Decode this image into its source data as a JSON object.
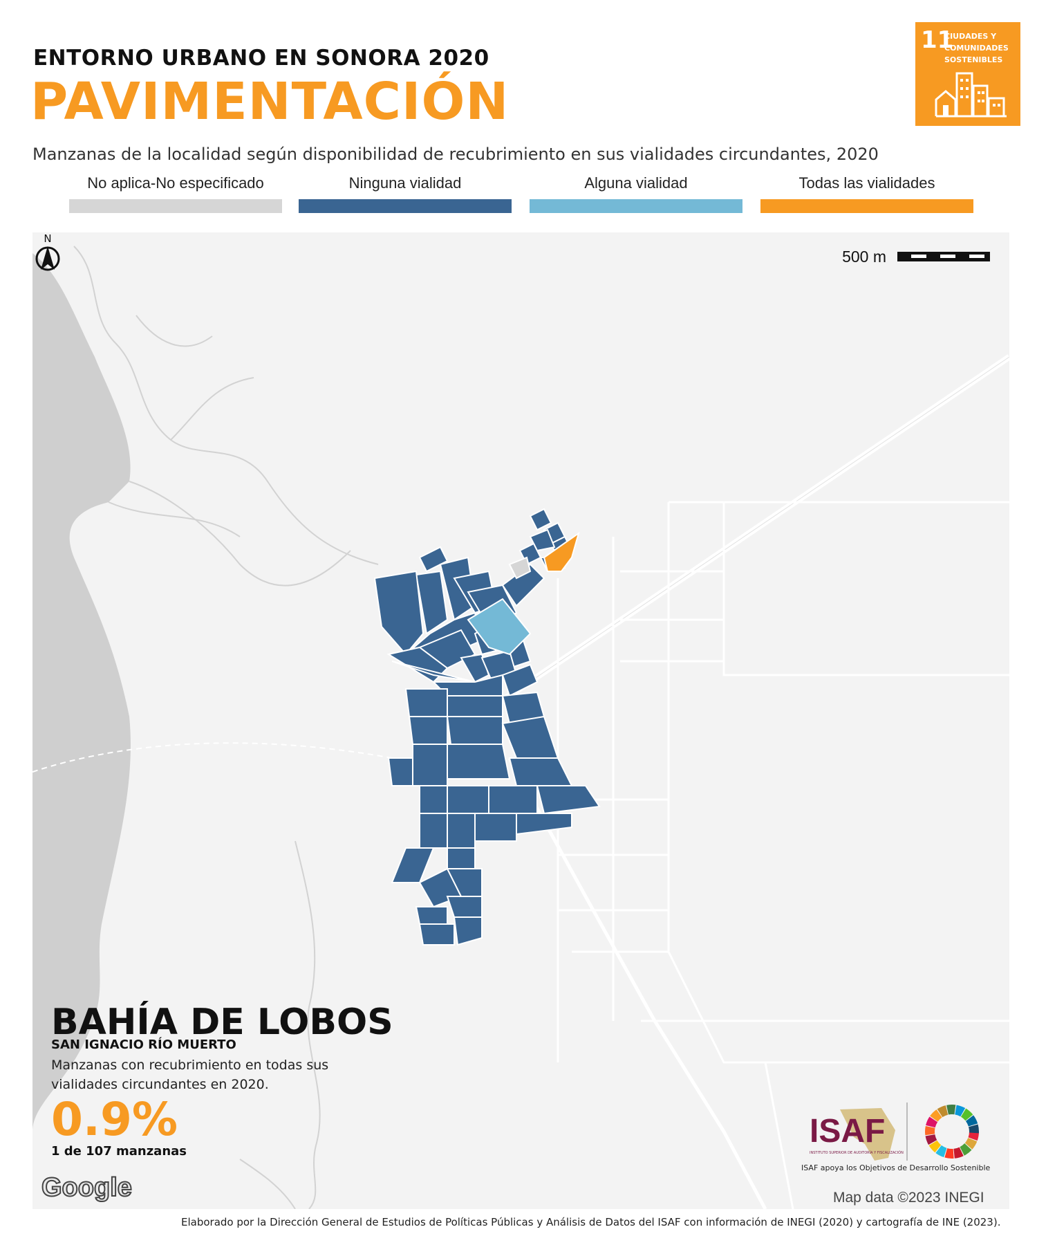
{
  "header": {
    "kicker": "ENTORNO URBANO EN SONORA 2020",
    "title": "PAVIMENTACIÓN",
    "subtitle": "Manzanas de la localidad según disponibilidad de recubrimiento en sus vialidades circundantes, 2020"
  },
  "sdg_badge": {
    "number": "11",
    "label": "CIUDADES Y\nCOMUNIDADES\nSOSTENIBLES",
    "color": "#f79a22"
  },
  "legend": [
    {
      "label": "No aplica-No especificado",
      "color": "#d6d6d6"
    },
    {
      "label": "Ninguna vialidad",
      "color": "#3a6592"
    },
    {
      "label": "Alguna vialidad",
      "color": "#74b9d6"
    },
    {
      "label": "Todas las vialidades",
      "color": "#f79a22"
    }
  ],
  "map": {
    "scale_label": "500 m",
    "north_label": "N",
    "water_color": "#cfcfcf",
    "land_color": "#f3f3f3",
    "block_category_colors": {
      "none": "#3a6592",
      "some": "#74b9d6",
      "all": "#f79a22",
      "na": "#d6d6d6"
    }
  },
  "locality": {
    "name": "BAHÍA DE LOBOS",
    "municipality": "SAN IGNACIO RÍO MUERTO",
    "description": "Manzanas con recubrimiento en todas sus\nvialidades circundantes en 2020.",
    "percentage": "0.9%",
    "count": "1 de 107 manzanas"
  },
  "logos": {
    "isaf": "ISAF",
    "isaf_small": "INSTITUTO SUPERIOR DE AUDITORÍA Y FISCALIZACIÓN",
    "isaf_caption": "ISAF apoya los Objetivos de Desarrollo Sostenible",
    "google": "Google"
  },
  "map_data": "Map data ©2023 INEGI",
  "credit": "Elaborado por la Dirección General de Estudios de Políticas Públicas y Análisis de Datos del ISAF con información de INEGI (2020) y cartografía de INE (2023)."
}
